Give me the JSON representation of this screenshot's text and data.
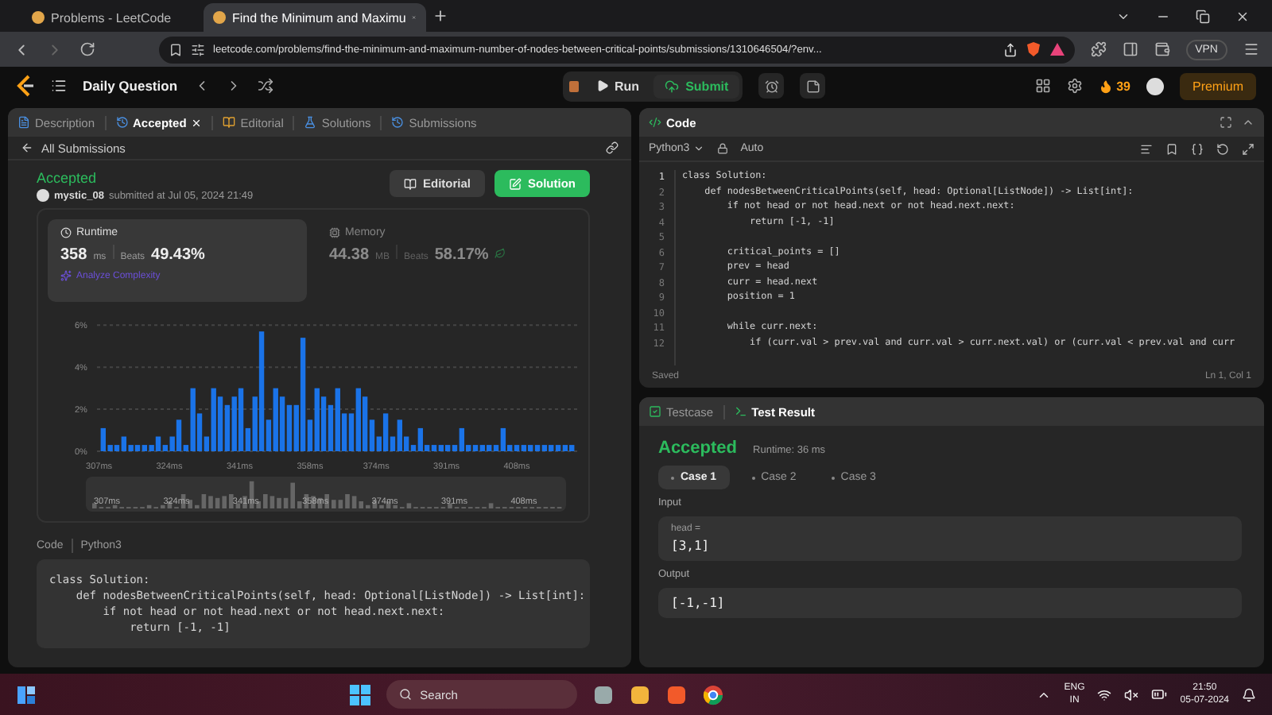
{
  "browser": {
    "tabs": [
      {
        "title": "Problems - LeetCode",
        "selected": false,
        "closable": false
      },
      {
        "title": "Find the Minimum and Maximu",
        "selected": true,
        "closable": true
      }
    ],
    "url": "leetcode.com/problems/find-the-minimum-and-maximum-number-of-nodes-between-critical-points/submissions/1310646504/?env...",
    "vpn": "VPN"
  },
  "nav": {
    "daily": "Daily Question",
    "run": "Run",
    "submit": "Submit",
    "streak": "39",
    "premium": "Premium"
  },
  "left_panel": {
    "tabs": [
      {
        "label": "Description",
        "selected": false,
        "closable": false
      },
      {
        "label": "Accepted",
        "selected": true,
        "closable": true
      },
      {
        "label": "Editorial",
        "selected": false,
        "closable": false
      },
      {
        "label": "Solutions",
        "selected": false,
        "closable": false
      },
      {
        "label": "Submissions",
        "selected": false,
        "closable": false
      }
    ],
    "back": "All Submissions",
    "status": "Accepted",
    "user": "mystic_08",
    "submitted": "submitted at Jul 05, 2024 21:49",
    "buttons": [
      {
        "label": "Editorial",
        "kind": "secondary"
      },
      {
        "label": "Solution",
        "kind": "primary"
      }
    ],
    "stats": [
      {
        "label": "Runtime",
        "value": "358",
        "unit": "ms",
        "beats_label": "Beats",
        "beats": "49.43%",
        "selected": true,
        "link": "Analyze Complexity"
      },
      {
        "label": "Memory",
        "value": "44.38",
        "unit": "MB",
        "beats_label": "Beats",
        "beats": "58.17%",
        "selected": false
      }
    ],
    "chart_data": {
      "type": "bar",
      "xlim": [
        306.5,
        422.6
      ],
      "ylim": [
        0,
        6.2
      ],
      "yticks": [
        {
          "value": 0,
          "label": "0%"
        },
        {
          "value": 2,
          "label": "2%"
        },
        {
          "value": 4,
          "label": "4%"
        },
        {
          "value": 6,
          "label": "6%"
        }
      ],
      "xticks": [
        {
          "value": 307,
          "label": "307ms"
        },
        {
          "value": 324,
          "label": "324ms"
        },
        {
          "value": 341,
          "label": "341ms"
        },
        {
          "value": 358,
          "label": "358ms"
        },
        {
          "value": 374,
          "label": "374ms"
        },
        {
          "value": 391,
          "label": "391ms"
        },
        {
          "value": 408,
          "label": "408ms"
        }
      ],
      "x": [
        308.0,
        309.7,
        311.3,
        313.0,
        314.7,
        316.3,
        318.0,
        319.7,
        321.3,
        323.0,
        324.7,
        326.3,
        328.0,
        329.7,
        331.3,
        333.0,
        334.7,
        336.3,
        338.0,
        339.7,
        341.3,
        343.0,
        344.7,
        346.3,
        348.0,
        349.7,
        351.3,
        353.0,
        354.7,
        356.3,
        358.0,
        359.7,
        361.3,
        363.0,
        364.7,
        366.3,
        368.0,
        369.7,
        371.3,
        373.0,
        374.7,
        376.3,
        378.0,
        379.7,
        381.3,
        383.0,
        384.7,
        386.3,
        388.0,
        389.7,
        391.3,
        393.0,
        394.7,
        396.3,
        398.0,
        399.7,
        401.3,
        403.0,
        404.7,
        406.3,
        408.0,
        409.7,
        411.3,
        413.0,
        414.7,
        416.3,
        418.0,
        419.7,
        421.3
      ],
      "series": [
        {
          "color": "#1a73e8",
          "values": [
            1.1,
            0.3,
            0.3,
            0.7,
            0.3,
            0.3,
            0.3,
            0.3,
            0.7,
            0.3,
            0.7,
            1.5,
            0.3,
            3.0,
            1.8,
            0.7,
            3.0,
            2.6,
            2.2,
            2.6,
            3.0,
            1.1,
            2.6,
            5.7,
            1.5,
            3.0,
            2.6,
            2.2,
            2.2,
            5.4,
            1.5,
            3.0,
            2.6,
            2.2,
            3.0,
            1.8,
            1.8,
            3.0,
            2.6,
            1.5,
            0.7,
            1.8,
            0.7,
            1.5,
            0.7,
            0.3,
            1.1,
            0.3,
            0.3,
            0.3,
            0.3,
            0.3,
            1.1,
            0.3,
            0.3,
            0.3,
            0.3,
            0.3,
            1.1,
            0.3,
            0.3,
            0.3,
            0.3,
            0.3,
            0.3,
            0.3,
            0.3,
            0.3,
            0.3
          ]
        }
      ],
      "grid": true
    },
    "overview": {
      "labels": [
        "307ms",
        "324ms",
        "341ms",
        "358ms",
        "374ms",
        "391ms",
        "408ms"
      ]
    },
    "code_label": "Code",
    "code_language": "Python3",
    "code": [
      "class Solution:",
      "    def nodesBetweenCriticalPoints(self, head: Optional[ListNode]) -> List[int]:",
      "        if not head or not head.next or not head.next.next:",
      "            return [-1, -1]"
    ]
  },
  "editor": {
    "title": "Code",
    "language": "Python3",
    "mode": "Auto",
    "lines": [
      {
        "number": "1",
        "text": "class Solution:"
      },
      {
        "number": "2",
        "text": "    def nodesBetweenCriticalPoints(self, head: Optional[ListNode]) -> List[int]:"
      },
      {
        "number": "3",
        "text": "        if not head or not head.next or not head.next.next:"
      },
      {
        "number": "4",
        "text": "            return [-1, -1]"
      },
      {
        "number": "5"
      },
      {
        "number": "6",
        "text": "        critical_points = []"
      },
      {
        "number": "7",
        "text": "        prev = head"
      },
      {
        "number": "8",
        "text": "        curr = head.next"
      },
      {
        "number": "9",
        "text": "        position = 1"
      },
      {
        "number": "10"
      },
      {
        "number": "11",
        "text": "        while curr.next:"
      },
      {
        "number": "12",
        "text": "            if (curr.val > prev.val and curr.val > curr.next.val) or (curr.val < prev.val and curr"
      }
    ],
    "status": "Saved",
    "cursor": "Ln 1, Col 1"
  },
  "test_panel": {
    "tabs": [
      {
        "label": "Testcase",
        "selected": false
      },
      {
        "label": "Test Result",
        "selected": true
      }
    ],
    "status": "Accepted",
    "runtime": "Runtime: 36 ms",
    "cases": [
      {
        "label": "Case 1",
        "selected": true
      },
      {
        "label": "Case 2",
        "selected": false
      },
      {
        "label": "Case 3",
        "selected": false
      }
    ],
    "input_label": "Input",
    "param": "head =",
    "input": "[3,1]",
    "output_label": "Output",
    "output": "[-1,-1]"
  },
  "taskbar": {
    "search": "Search",
    "lang": "ENG",
    "region": "IN",
    "time": "21:50",
    "date": "05-07-2024"
  }
}
